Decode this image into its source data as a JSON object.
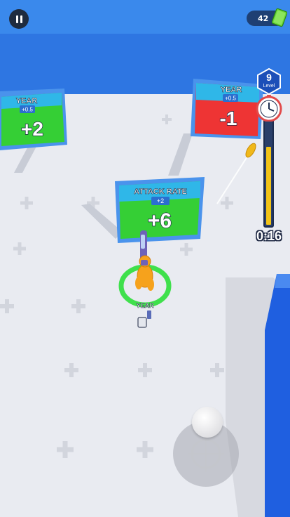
{
  "hud": {
    "currency_amount": "42",
    "level_number": "9",
    "level_label": "Level",
    "timer": "0:16",
    "timer_fill_fraction": 0.75,
    "icons": [
      "pause-icon",
      "cash-icon",
      "clock-icon",
      "joystick-icon"
    ]
  },
  "gates": [
    {
      "title": "YEAR",
      "rate": "+0.5",
      "value": "+2",
      "color": "green"
    },
    {
      "title": "YEAR",
      "rate": "+0.5",
      "value": "-1",
      "color": "red"
    },
    {
      "title": "ATTACK RATE",
      "rate": "+2",
      "value": "+6",
      "color": "green"
    }
  ],
  "player": {
    "label": "YEAR"
  },
  "colors": {
    "sky": "#3a87ea",
    "floor": "#e9ebf1",
    "gate_green": "#35cf35",
    "gate_red": "#ee3434",
    "frame_blue": "#4a93ec",
    "player_orange": "#f6a21c",
    "accent_yellow": "#f2c316"
  }
}
